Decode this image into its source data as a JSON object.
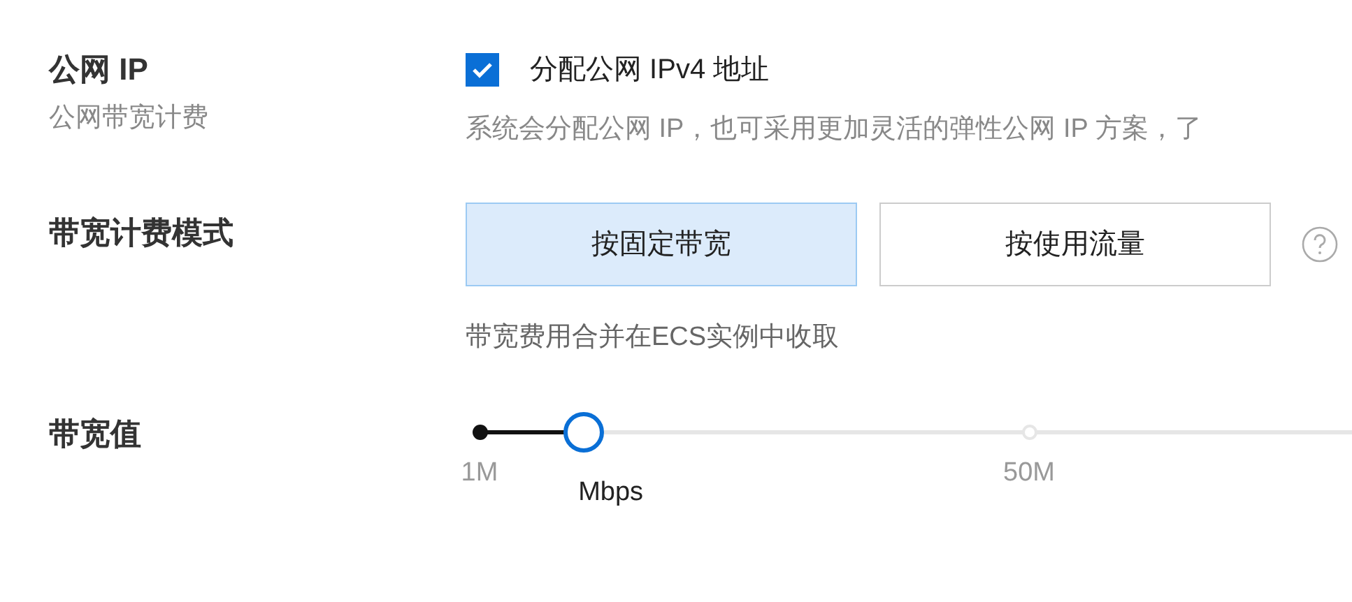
{
  "public_ip": {
    "label": "公网 IP",
    "sublabel": "公网带宽计费",
    "checkbox": {
      "label": "分配公网 IPv4 地址",
      "checked": true
    },
    "description": "系统会分配公网 IP，也可采用更加灵活的弹性公网 IP 方案，了"
  },
  "billing_mode": {
    "label": "带宽计费模式",
    "options": [
      {
        "label": "按固定带宽",
        "selected": true
      },
      {
        "label": "按使用流量",
        "selected": false
      }
    ],
    "note": "带宽费用合并在ECS实例中收取"
  },
  "bandwidth": {
    "label": "带宽值",
    "slider": {
      "level": 0.093
    },
    "ticks": [
      {
        "label": "1M"
      },
      {
        "label": "50M"
      }
    ],
    "unit": "Mbps"
  }
}
